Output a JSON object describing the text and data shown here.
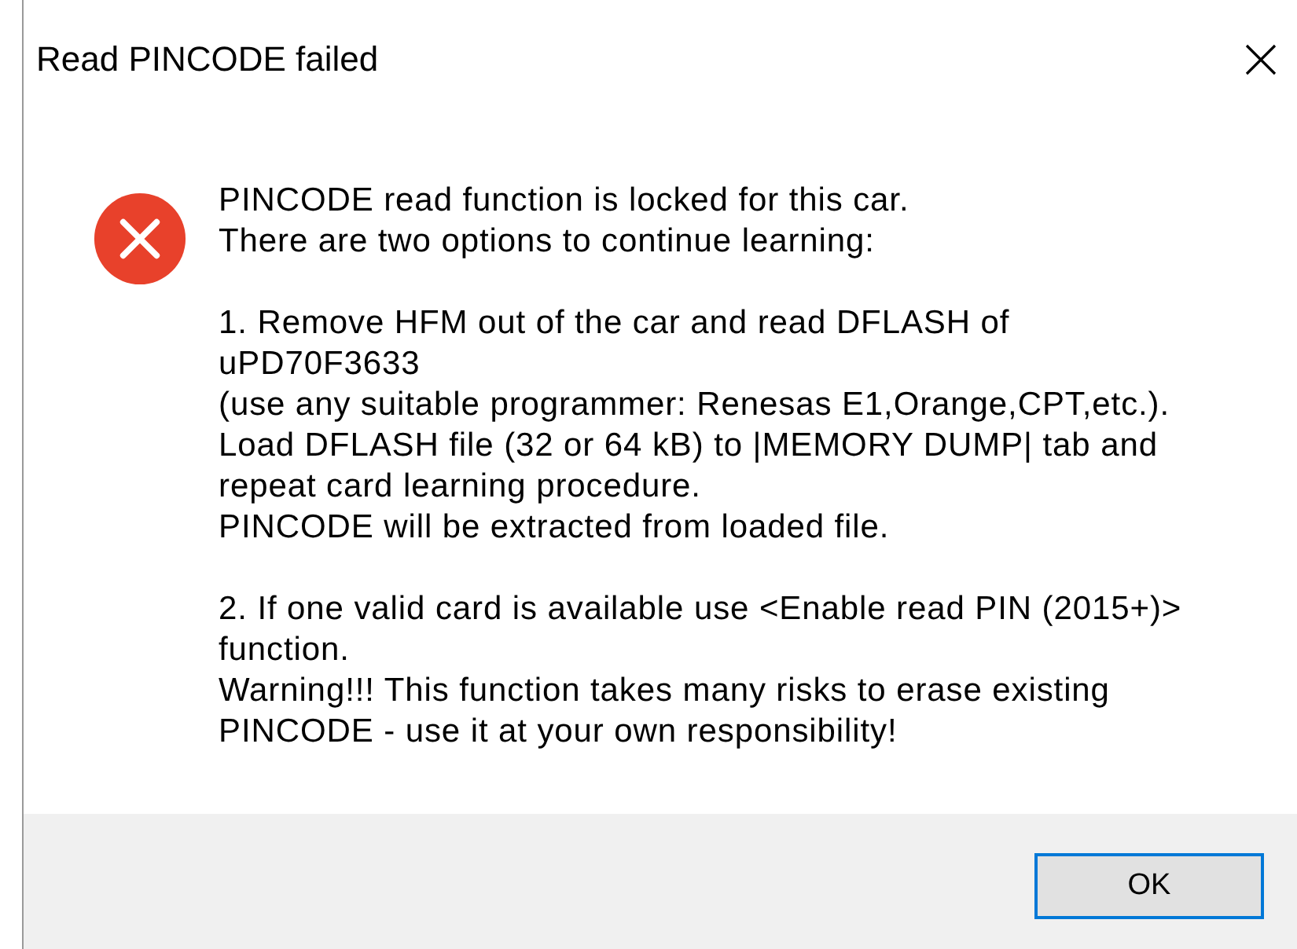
{
  "window": {
    "title": "Read PINCODE failed"
  },
  "message": {
    "kind": "error",
    "paragraphs": [
      {
        "lines": [
          "PINCODE read function is locked for this car.",
          "There are two options to continue learning:"
        ]
      },
      {
        "lines": [
          "1. Remove HFM out of the car and read DFLASH of",
          "uPD70F3633",
          "(use any suitable programmer: Renesas E1,Orange,CPT,etc.).",
          "Load DFLASH file (32 or 64 kB) to |MEMORY DUMP| tab and",
          "repeat card learning procedure.",
          "PINCODE will be extracted from loaded file."
        ]
      },
      {
        "lines": [
          "2. If one valid card is available use <Enable read PIN (2015+)>",
          "function.",
          "Warning!!! This function takes many risks to erase existing",
          "PINCODE - use it at your own responsibility!"
        ]
      }
    ]
  },
  "buttons": [
    {
      "label": "OK",
      "default": true
    }
  ]
}
